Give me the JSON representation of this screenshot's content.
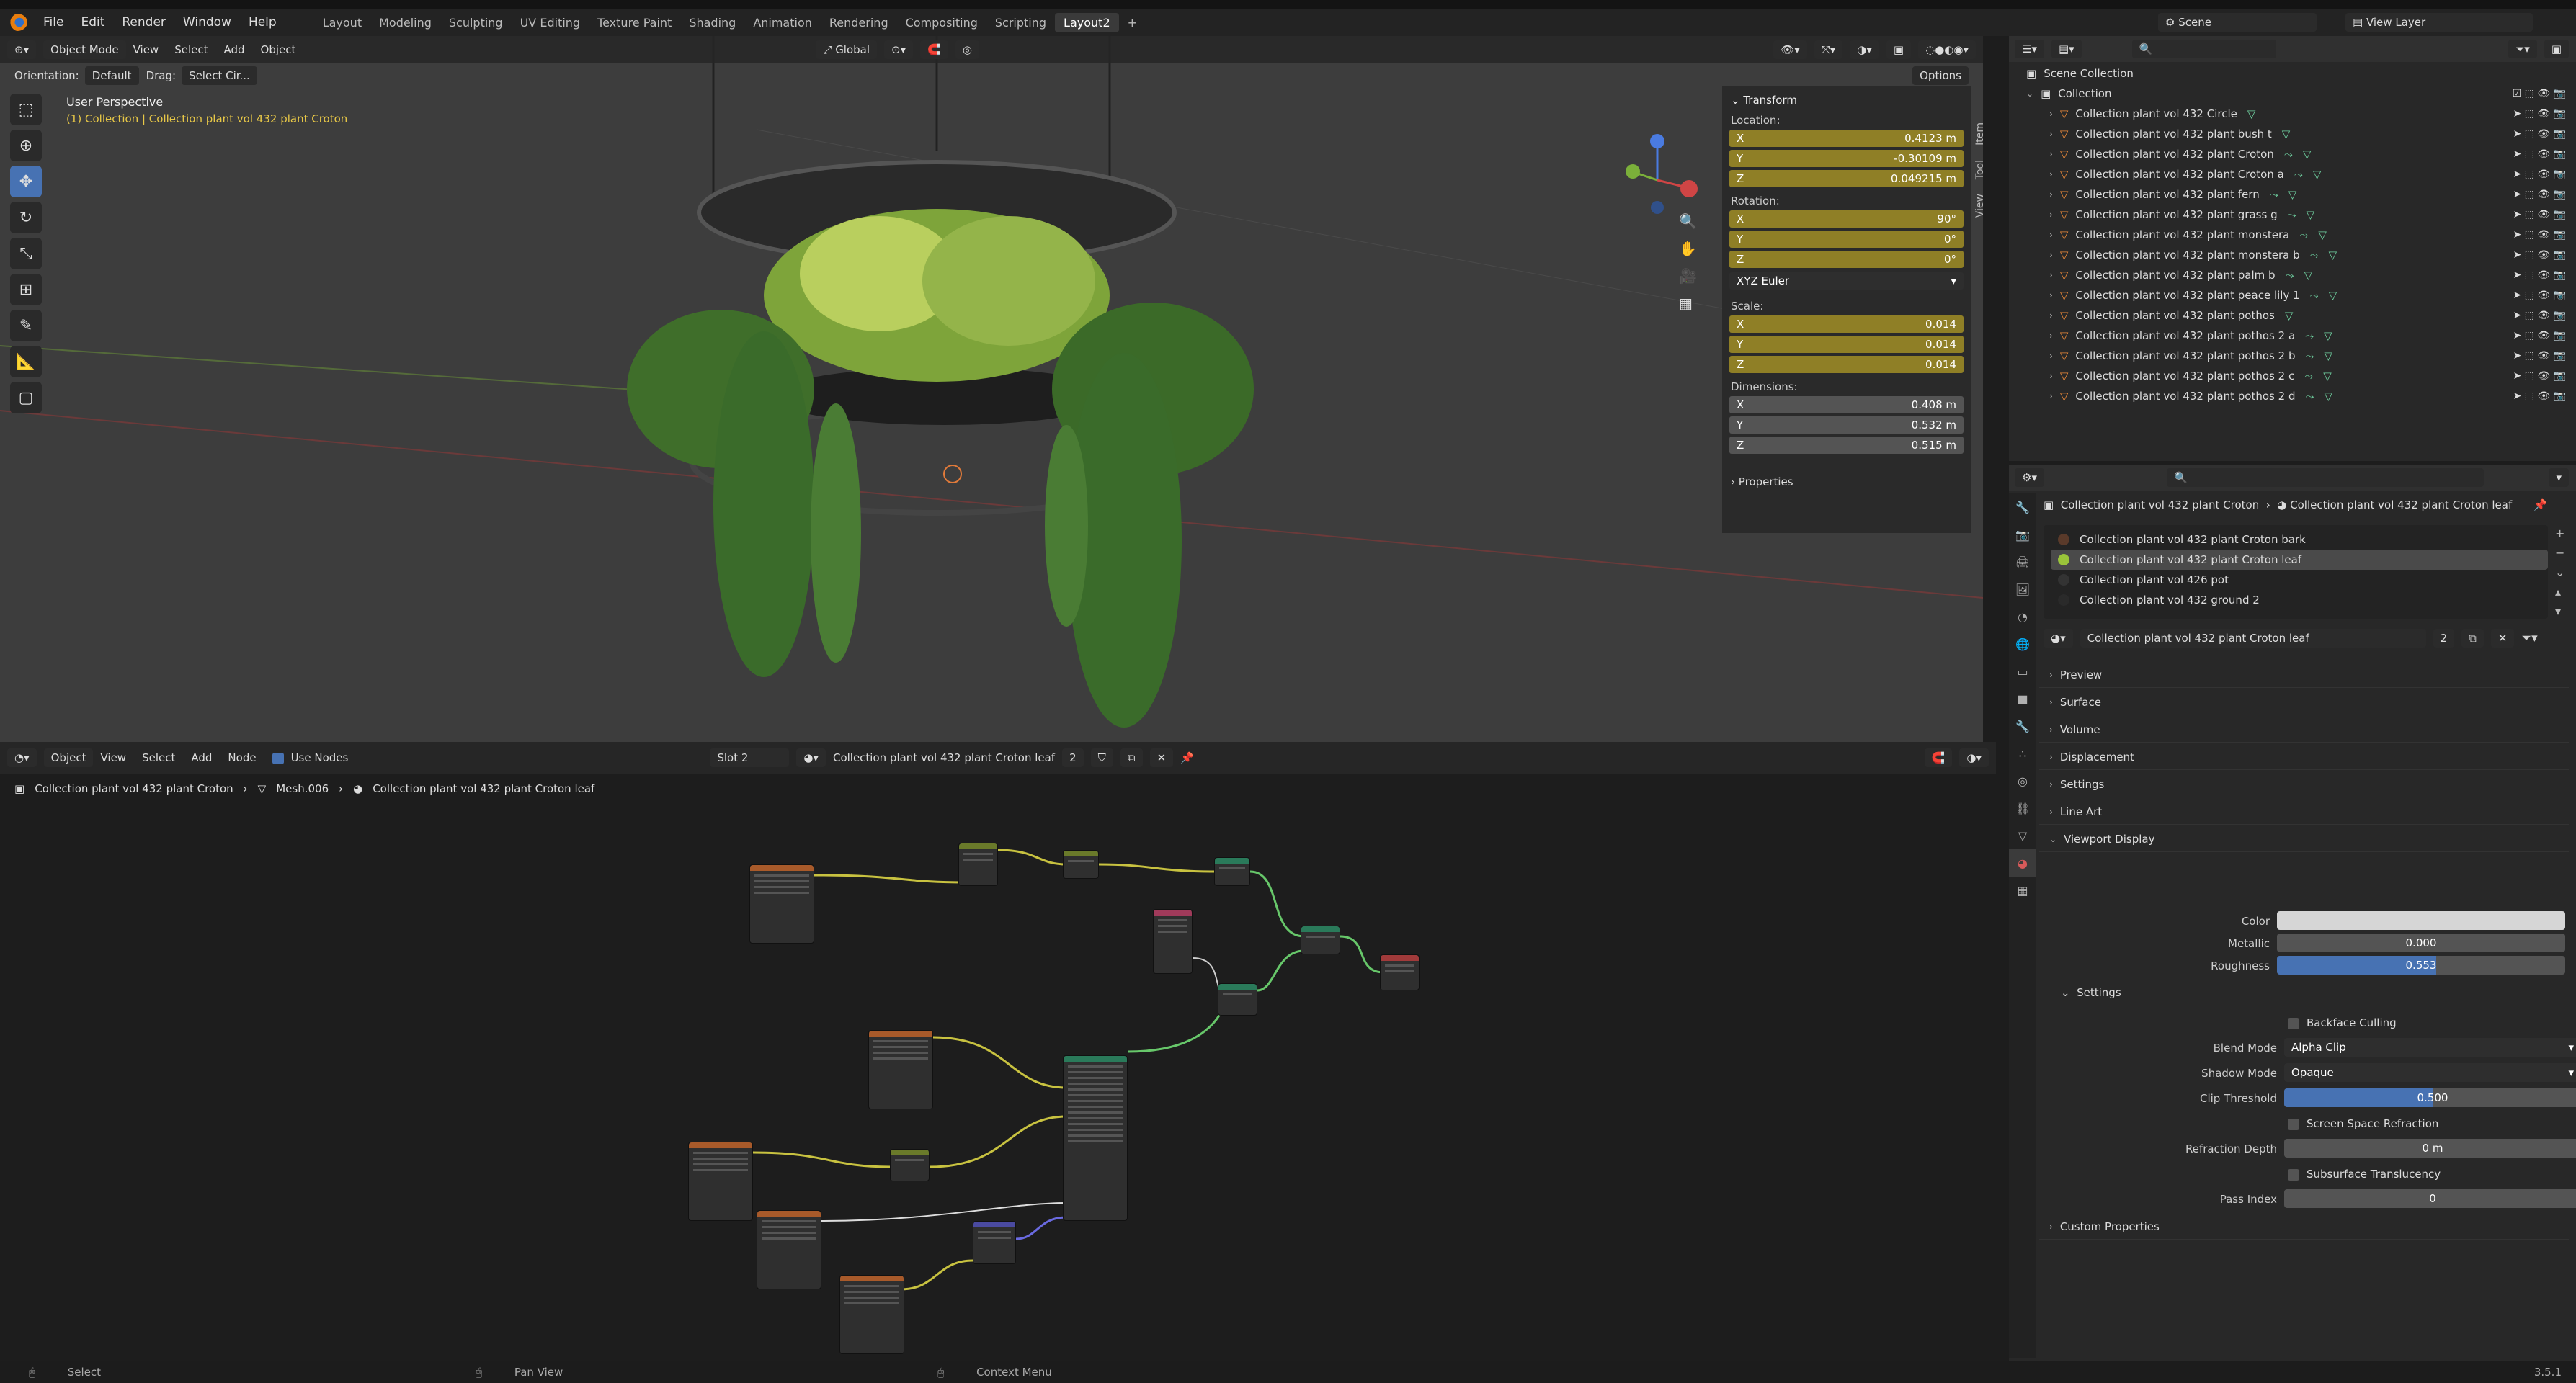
{
  "menu": {
    "items": [
      "File",
      "Edit",
      "Render",
      "Window",
      "Help"
    ],
    "workspaces": [
      "Layout",
      "Modeling",
      "Sculpting",
      "UV Editing",
      "Texture Paint",
      "Shading",
      "Animation",
      "Rendering",
      "Compositing",
      "Scripting",
      "Layout2"
    ],
    "add_tab": "+",
    "scene_label": "Scene",
    "view_layer_label": "View Layer"
  },
  "viewport": {
    "mode": "Object Mode",
    "view": "View",
    "select": "Select",
    "add": "Add",
    "object": "Object",
    "transform_orientation": "Global",
    "orientation_label": "Orientation:",
    "orientation_value": "Default",
    "drag_label": "Drag:",
    "drag_value": "Select Cir...",
    "options": "Options",
    "info_title": "User Perspective",
    "info_collection": "(1) Collection | Collection plant vol 432 plant Croton"
  },
  "npanel": {
    "section": "Transform",
    "location_label": "Location:",
    "loc": {
      "x": "0.4123 m",
      "y": "-0.30109 m",
      "z": "0.049215 m"
    },
    "rotation_label": "Rotation:",
    "rot": {
      "x": "90°",
      "y": "0°",
      "z": "0°"
    },
    "rot_mode": "XYZ Euler",
    "scale_label": "Scale:",
    "scale": {
      "x": "0.014",
      "y": "0.014",
      "z": "0.014"
    },
    "dimensions_label": "Dimensions:",
    "dim": {
      "x": "0.408 m",
      "y": "0.532 m",
      "z": "0.515 m"
    },
    "axis": {
      "x": "X",
      "y": "Y",
      "z": "Z"
    },
    "properties": "Properties",
    "tabs": [
      "Item",
      "Tool",
      "View"
    ]
  },
  "node_editor": {
    "type": "Object",
    "view": "View",
    "select": "Select",
    "add": "Add",
    "node": "Node",
    "use_nodes": "Use Nodes",
    "slot": "Slot 2",
    "material": "Collection plant vol 432 plant Croton leaf",
    "users": "2",
    "breadcrumb": [
      "Collection plant vol 432 plant Croton",
      "Mesh.006",
      "Collection plant vol 432 plant Croton leaf"
    ]
  },
  "status": {
    "select": "Select",
    "pan": "Pan View",
    "context": "Context Menu",
    "version": "3.5.1"
  },
  "outliner": {
    "scene_collection": "Scene Collection",
    "collection": "Collection",
    "items": [
      "Collection plant vol 432  Circle",
      "Collection plant vol 432 plant bush t",
      "Collection plant vol 432 plant Croton",
      "Collection plant vol 432 plant Croton a",
      "Collection plant vol 432 plant fern",
      "Collection plant vol 432 plant grass g",
      "Collection plant vol 432 plant monstera",
      "Collection plant vol 432 plant monstera b",
      "Collection plant vol 432 plant palm b",
      "Collection plant vol 432 plant peace lily 1",
      "Collection plant vol 432 plant pothos",
      "Collection plant vol 432 plant pothos 2 a",
      "Collection plant vol 432 plant pothos 2 b",
      "Collection plant vol 432 plant pothos 2 c",
      "Collection plant vol 432 plant pothos 2 d"
    ]
  },
  "properties": {
    "bread1": "Collection plant vol 432 plant Croton",
    "bread2": "Collection plant vol 432 plant Croton leaf",
    "slots": [
      "Collection plant vol 432 plant Croton bark",
      "Collection plant vol 432 plant Croton leaf",
      "Collection plant vol 426 pot",
      "Collection plant vol 432 ground 2"
    ],
    "material_name": "Collection plant vol 432 plant Croton leaf",
    "material_users": "2",
    "sections": [
      "Preview",
      "Surface",
      "Volume",
      "Displacement",
      "Settings",
      "Line Art",
      "Viewport Display"
    ],
    "color_label": "Color",
    "metallic_label": "Metallic",
    "metallic": "0.000",
    "roughness_label": "Roughness",
    "roughness": "0.553",
    "settings_sub": "Settings",
    "backface": "Backface Culling",
    "blend_label": "Blend Mode",
    "blend": "Alpha Clip",
    "shadow_label": "Shadow Mode",
    "shadow": "Opaque",
    "clip_label": "Clip Threshold",
    "clip": "0.500",
    "ssr": "Screen Space Refraction",
    "refr_label": "Refraction Depth",
    "refr": "0 m",
    "sss": "Subsurface Translucency",
    "pass_label": "Pass Index",
    "pass": "0",
    "custom": "Custom Properties"
  }
}
